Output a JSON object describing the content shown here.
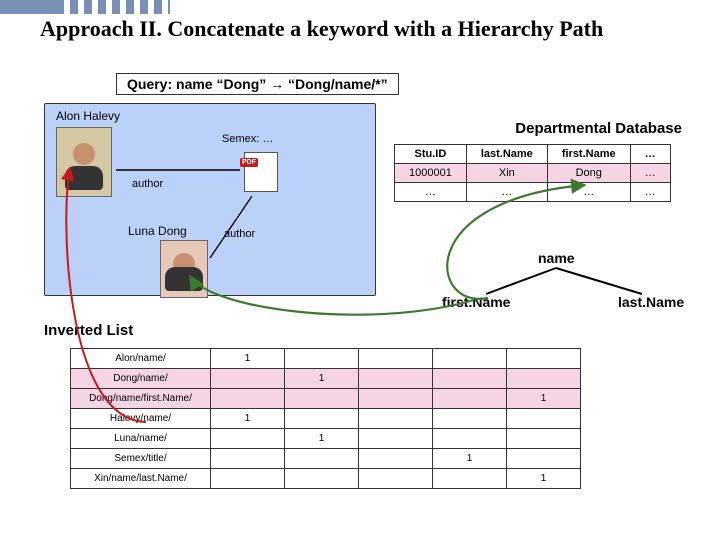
{
  "title": "Approach II. Concatenate a keyword with a Hierarchy Path",
  "query_label_prefix": "Query: name “Dong” → “Dong/name/*”",
  "graph": {
    "person1": "Alon Halevy",
    "person2": "Luna Dong",
    "edge_author1": "author",
    "edge_author2": "author",
    "semex": "Semex: …"
  },
  "db": {
    "title": "Departmental Database",
    "headers": [
      "Stu.ID",
      "last.Name",
      "first.Name",
      "…"
    ],
    "rows": [
      [
        "1000001",
        "Xin",
        "Dong",
        "…"
      ],
      [
        "…",
        "…",
        "…",
        "…"
      ]
    ]
  },
  "tree": {
    "root": "name",
    "left": "first.Name",
    "right": "last.Name"
  },
  "inverted": {
    "title": "Inverted List",
    "rows": [
      {
        "key": "Alon/name/",
        "cells": [
          "1",
          "",
          "",
          "",
          ""
        ]
      },
      {
        "key": "Dong/name/",
        "cells": [
          "",
          "1",
          "",
          "",
          ""
        ],
        "hl": true
      },
      {
        "key": "Dong/name/first.Name/",
        "cells": [
          "",
          "",
          "",
          "",
          "1"
        ],
        "hl": true
      },
      {
        "key": "Halevy/name/",
        "cells": [
          "1",
          "",
          "",
          "",
          ""
        ]
      },
      {
        "key": "Luna/name/",
        "cells": [
          "",
          "1",
          "",
          "",
          ""
        ]
      },
      {
        "key": "Semex/title/",
        "cells": [
          "",
          "",
          "",
          "1",
          ""
        ]
      },
      {
        "key": "Xin/name/last.Name/",
        "cells": [
          "",
          "",
          "",
          "",
          "1"
        ]
      }
    ]
  }
}
